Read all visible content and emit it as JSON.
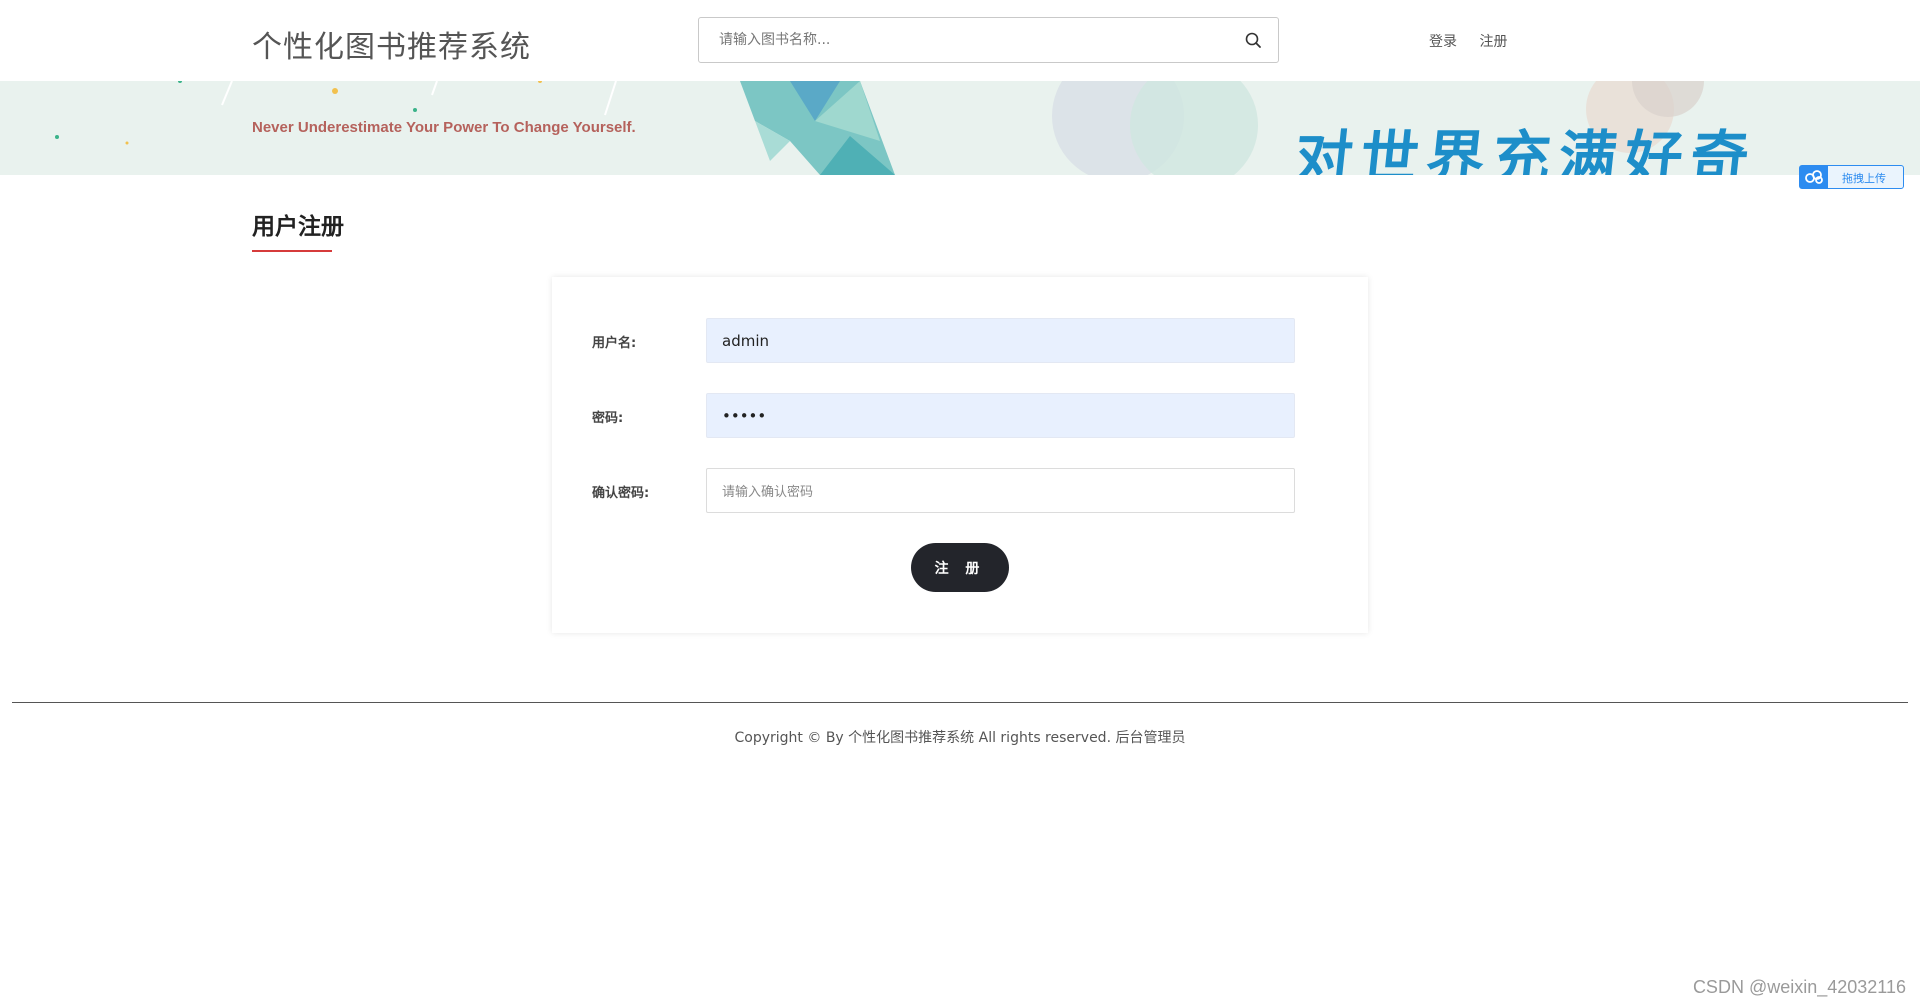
{
  "header": {
    "site_title": "个性化图书推荐系统",
    "search_placeholder": "请输入图书名称...",
    "nav": {
      "login": "登录",
      "register": "注册"
    }
  },
  "banner": {
    "tagline": "Never Underestimate Your Power To Change Yourself.",
    "slogan": "对世界充满好奇"
  },
  "upload_widget": {
    "label": "拖拽上传"
  },
  "page": {
    "section_title": "用户注册"
  },
  "form": {
    "username": {
      "label": "用户名:",
      "value": "admin"
    },
    "password": {
      "label": "密码:",
      "value": "•••••"
    },
    "confirm_password": {
      "label": "确认密码:",
      "placeholder": "请输入确认密码"
    },
    "submit_label": "注 册"
  },
  "footer": {
    "copyright": "Copyright © By 个性化图书推荐系统 All rights reserved.",
    "admin_link": "后台管理员"
  },
  "watermark": "CSDN @weixin_42032116",
  "colors": {
    "accent_underline": "#d63b3b",
    "button_bg": "#23252b",
    "tagline": "#b5625c",
    "slogan": "#1d8ec9",
    "banner_bg": "#e9f2ee",
    "autofill_bg": "#e8f0fe"
  }
}
